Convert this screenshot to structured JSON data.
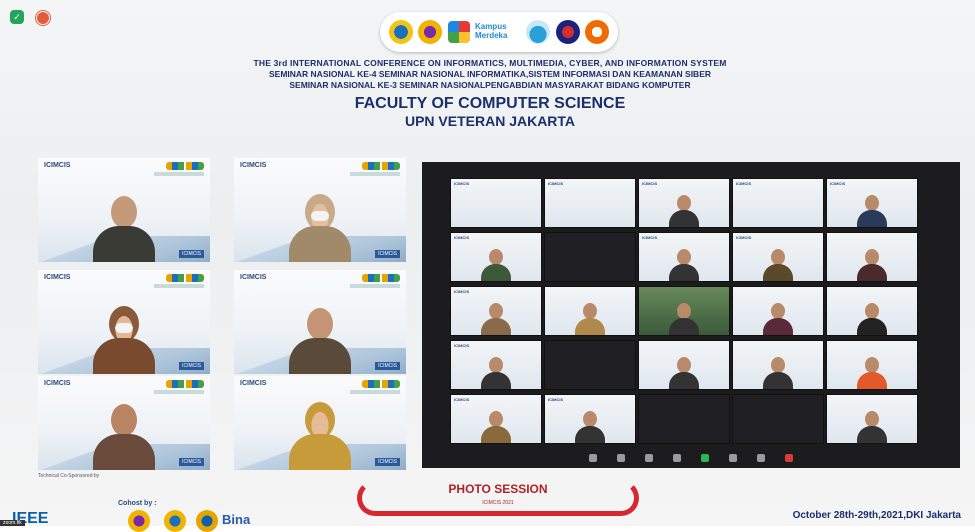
{
  "header": {
    "title_line1": "THE 3rd INTERNATIONAL CONFERENCE ON INFORMATICS, MULTIMEDIA, CYBER, AND INFORMATION SYSTEM",
    "title_line2": "SEMINAR NASIONAL KE-4 SEMINAR NASIONAL INFORMATIKA,SISTEM INFORMASI DAN KEAMANAN SIBER",
    "title_line3": "SEMINAR NASIONAL KE-3 SEMINAR NASIONALPENGABDIAN MASYARAKAT BIDANG KOMPUTER",
    "faculty": "FACULTY OF COMPUTER SCIENCE",
    "university": "UPN VETERAN JAKARTA",
    "logo_kampus": "Kampus Merdeka"
  },
  "tile_header": "ICIMCIS",
  "tile_tag": "ICIMCIS",
  "bottom": {
    "tech_sponsor": "Technical Co-Sponsored by",
    "ieee": "IEEE",
    "cohost": "Cohost by :",
    "bina": "Bina",
    "photo_session": "PHOTO SESSION",
    "photo_sub": "ICIMCIS 2021",
    "date": "October 28th-29th,2021,DKI Jakarta",
    "zoomfix": "zoom.fik"
  },
  "colors": {
    "accent": "#1b2f6b",
    "ribbon": "#d7282f",
    "zoom_bg": "#1c1c1e"
  }
}
